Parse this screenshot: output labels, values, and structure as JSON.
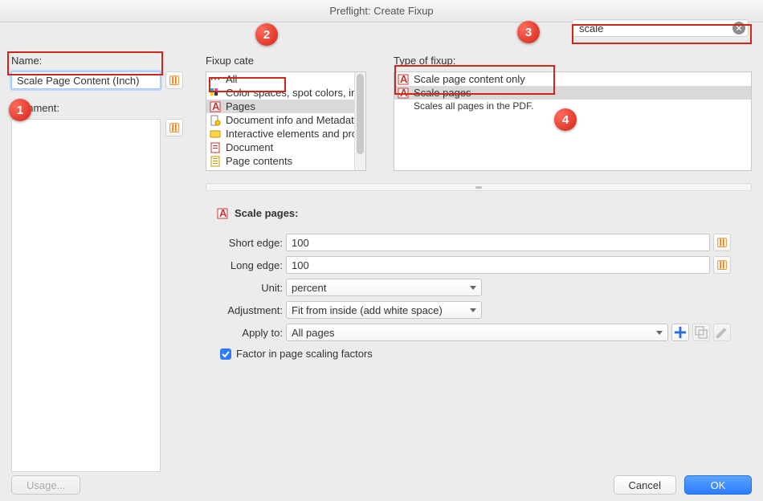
{
  "window_title": "Preflight: Create Fixup",
  "labels": {
    "name": "Name:",
    "comment": "Comment:",
    "fixup_cat": "Fixup cate",
    "type_of_fixup": "Type of fixup:",
    "scale_pages_heading": "Scale pages:",
    "short_edge": "Short edge:",
    "long_edge": "Long edge:",
    "unit": "Unit:",
    "adjustment": "Adjustment:",
    "apply_to": "Apply to:",
    "factor": "Factor in page scaling factors"
  },
  "inputs": {
    "name_value": "Scale Page Content (Inch)",
    "comment_value": "",
    "search_value": "scale",
    "short_edge_value": "100",
    "long_edge_value": "100"
  },
  "selects": {
    "unit": "percent",
    "adjustment": "Fit from inside (add white space)",
    "apply_to": "All pages"
  },
  "categories": [
    {
      "label": "All",
      "sel": false
    },
    {
      "label": "Color spaces, spot colors, inks",
      "sel": false
    },
    {
      "label": "Pages",
      "sel": true
    },
    {
      "label": "Document info and Metadata",
      "sel": false
    },
    {
      "label": "Interactive elements and proper",
      "sel": false
    },
    {
      "label": "Document",
      "sel": false
    },
    {
      "label": "Page contents",
      "sel": false
    }
  ],
  "types": {
    "items": [
      {
        "label": "Scale page content only",
        "sel": false
      },
      {
        "label": "Scale pages",
        "sel": true
      }
    ],
    "desc": "Scales all pages in the PDF."
  },
  "buttons": {
    "usage": "Usage...",
    "cancel": "Cancel",
    "ok": "OK"
  },
  "callouts": {
    "c1": "1",
    "c2": "2",
    "c3": "3",
    "c4": "4"
  }
}
